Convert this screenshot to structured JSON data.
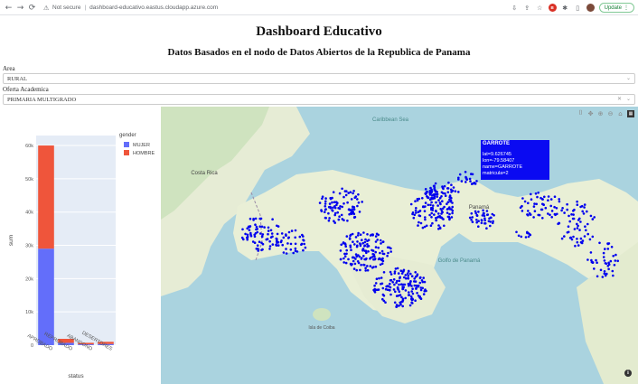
{
  "browser": {
    "security_label": "Not secure",
    "url": "dashboard-educativo.eastus.cloudapp.azure.com",
    "update_label": "Update"
  },
  "page": {
    "title": "Dashboard Educativo",
    "subtitle": "Datos Basados en el nodo de Datos Abiertos de la Republica de Panama"
  },
  "filters": {
    "area_label": "Area",
    "area_value": "RURAL",
    "oferta_label": "Oferta Academica",
    "oferta_value": "PRIMARIA MULTIGRADO"
  },
  "chart_data": {
    "type": "bar",
    "stacked": true,
    "categories": [
      "APROBADO",
      "REPROBADO",
      "ABANDONO",
      "DESERTORES"
    ],
    "series": [
      {
        "name": "MUJER",
        "values": [
          29000,
          700,
          250,
          350
        ],
        "color": "#636efa"
      },
      {
        "name": "HOMBRE",
        "values": [
          31000,
          1200,
          450,
          650
        ],
        "color": "#ef553b"
      }
    ],
    "xlabel": "status",
    "ylabel": "sum",
    "legend_title": "gender",
    "ylim": [
      0,
      63000
    ],
    "yticks": [
      0,
      10000,
      20000,
      30000,
      40000,
      50000,
      60000
    ],
    "ytick_labels": [
      "0",
      "10k",
      "20k",
      "30k",
      "40k",
      "50k",
      "60k"
    ],
    "plot_bg": "#e5ecf6"
  },
  "map": {
    "tooltip": {
      "title": "GARROTE",
      "lat_line": "lat=9.626745",
      "lon_line": "lon=-79.58407",
      "name_line": "name=GARROTE",
      "matricula_line": "matricula=2"
    },
    "labels": {
      "sea": "Caribbean Sea",
      "gulf": "Golfo de Panamá",
      "panama": "Panamá",
      "costa_rica": "Costa Rica",
      "coiba": "Isla de Coiba"
    },
    "point_color": "#0000ee"
  }
}
